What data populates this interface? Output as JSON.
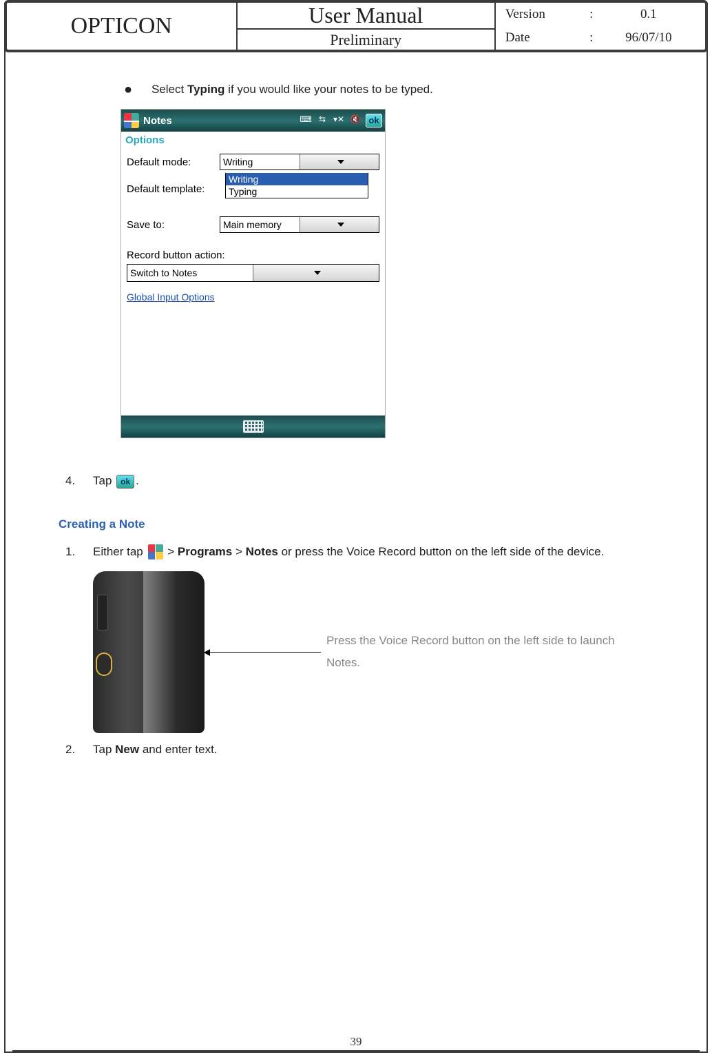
{
  "header": {
    "brand": "OPTICON",
    "title": "User Manual",
    "subtitle": "Preliminary",
    "version_label": "Version",
    "version_value": "0.1",
    "date_label": "Date",
    "date_value": "96/07/10",
    "colon": ":"
  },
  "bullet": {
    "pre": "Select ",
    "bold": "Typing",
    "post": " if you would like your notes to be typed."
  },
  "screenshot": {
    "title": "Notes",
    "ok": "ok",
    "options": "Options",
    "rows": {
      "default_mode_label": "Default mode:",
      "default_mode_value": "Writing",
      "default_template_label": "Default template:",
      "save_to_label": "Save to:",
      "save_to_value": "Main memory"
    },
    "dropdown": {
      "opt1": "Writing",
      "opt2": "Typing"
    },
    "record_label": "Record button action:",
    "record_value": "Switch to Notes",
    "global_link": "Global Input Options"
  },
  "step4": {
    "num": "4.",
    "pre": "Tap ",
    "ok": "ok",
    "post": "."
  },
  "heading": "Creating a Note",
  "step1": {
    "num": "1.",
    "pre": "Either tap ",
    "mid1": " > ",
    "b1": "Programs",
    "mid2": " > ",
    "b2": "Notes",
    "post": " or press the Voice Record button on the left side of the device."
  },
  "caption": {
    "line1": "Press the Voice Record button on the left side to launch",
    "line2": "Notes."
  },
  "step2": {
    "num": "2.",
    "pre": "Tap ",
    "b": "New",
    "post": " and enter text."
  },
  "page_number": "39"
}
